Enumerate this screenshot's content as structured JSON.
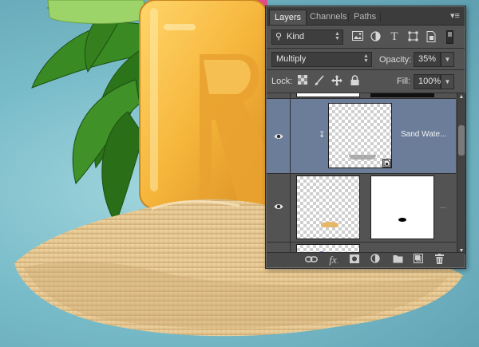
{
  "panel": {
    "tabs": [
      {
        "label": "Layers",
        "active": true
      },
      {
        "label": "Channels",
        "active": false
      },
      {
        "label": "Paths",
        "active": false
      }
    ],
    "filter": {
      "value": "Kind"
    },
    "blend_mode": {
      "value": "Multiply"
    },
    "opacity": {
      "label": "Opacity:",
      "value": "35%"
    },
    "lock": {
      "label": "Lock:"
    },
    "fill": {
      "label": "Fill:",
      "value": "100%"
    },
    "layers": [
      {
        "name": "Sand Wate...",
        "visible": true,
        "selected": true,
        "clipped": true,
        "smart_object": true
      },
      {
        "name": "",
        "visible": true,
        "selected": false,
        "has_mask": true
      },
      {
        "name": "",
        "visible": true,
        "selected": false
      }
    ],
    "bottom_icons": [
      "link-layers-icon",
      "fx-icon",
      "add-mask-icon",
      "adjustment-layer-icon",
      "new-group-icon",
      "new-layer-icon",
      "trash-icon"
    ],
    "fx_label": "fx"
  },
  "colors": {
    "panel_bg": "#535353",
    "selected_layer": "#6b7d99",
    "sky": "#79bcc9",
    "sand": "#e3c58e",
    "letter": "#f5b93e"
  }
}
